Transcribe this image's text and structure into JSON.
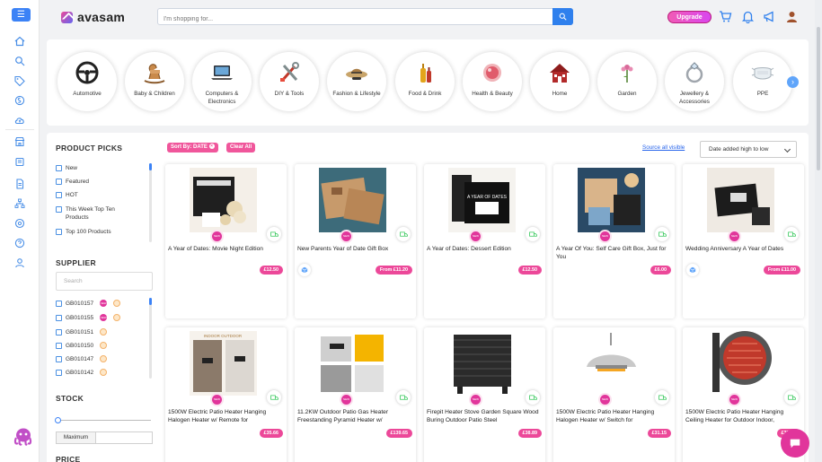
{
  "header": {
    "brand": "avasam",
    "search_placeholder": "I'm shopping for...",
    "upgrade_label": "Upgrade"
  },
  "categories": [
    {
      "label": "Automotive",
      "icon": "steering-wheel-icon"
    },
    {
      "label": "Baby & Children",
      "icon": "rocking-horse-icon"
    },
    {
      "label": "Computers & Electronics",
      "icon": "laptop-icon"
    },
    {
      "label": "DIY & Tools",
      "icon": "tools-icon"
    },
    {
      "label": "Fashion & Lifestyle",
      "icon": "hat-icon"
    },
    {
      "label": "Food & Drink",
      "icon": "bottles-icon"
    },
    {
      "label": "Health & Beauty",
      "icon": "compact-icon"
    },
    {
      "label": "Home",
      "icon": "house-icon"
    },
    {
      "label": "Garden",
      "icon": "flower-icon"
    },
    {
      "label": "Jewellery & Accessories",
      "icon": "ring-icon"
    },
    {
      "label": "PPE",
      "icon": "mask-icon"
    }
  ],
  "filters": {
    "product_picks_title": "PRODUCT PICKS",
    "product_picks": [
      "New",
      "Featured",
      "HOT",
      "This Week Top Ten Products",
      "Top 100 Products"
    ],
    "supplier_title": "SUPPLIER",
    "supplier_search_placeholder": "Search",
    "suppliers": [
      {
        "code": "GB010157",
        "new": true,
        "fire": true
      },
      {
        "code": "GB010155",
        "new": true,
        "fire": true
      },
      {
        "code": "GB010151",
        "new": false,
        "fire": true
      },
      {
        "code": "GB010150",
        "new": false,
        "fire": true
      },
      {
        "code": "GB010147",
        "new": false,
        "fire": true
      },
      {
        "code": "GB010142",
        "new": false,
        "fire": true
      }
    ],
    "stock_title": "STOCK",
    "maximum_label": "Maximum",
    "price_title": "PRICE"
  },
  "toolbar": {
    "sort_pill": "Sort By: DATE",
    "clear_all": "Clear All",
    "source_all_visible": "Source all visible",
    "sort_select": "Date added high to low"
  },
  "products": [
    {
      "title": "A Year of Dates: Movie Night Edition",
      "price": "£12.50",
      "cube": false
    },
    {
      "title": "New Parents Year of Date Gift Box",
      "price": "From £11.20",
      "cube": true
    },
    {
      "title": "A Year of Dates: Dessert Edition",
      "price": "£12.50",
      "cube": false
    },
    {
      "title": "A Year Of You: Self Care Gift Box, Just for You",
      "price": "£6.00",
      "cube": false
    },
    {
      "title": "Wedding Anniversary A Year of Dates",
      "price": "From £11.00",
      "cube": true
    },
    {
      "title": "1500W Electric Patio Heater Hanging Halogen Heater w/ Remote for",
      "price": "£35.66",
      "cube": false
    },
    {
      "title": "11.2KW Outdoor Patio Gas Heater Freestanding Pyramid Heater w/",
      "price": "£139.65",
      "cube": false
    },
    {
      "title": "Firepit Heater Stove Garden Square Wood Buring Outdoor Patio Steel",
      "price": "£38.89",
      "cube": false
    },
    {
      "title": "1500W Electric Patio Heater Hanging Halogen Heater w/ Switch for",
      "price": "£31.15",
      "cube": false
    },
    {
      "title": "1500W Electric Patio Heater Hanging Ceiling Heater for Outdoor Indoor,",
      "price": "£35.66",
      "cube": false
    }
  ],
  "image_texts": {
    "dessert_box": "A YEAR OF DATES",
    "heater_banner": "INDOOR OUTDOOR"
  },
  "colors": {
    "accent_blue": "#2f80ed",
    "brand_pink": "#ec4899",
    "new_badge": "#e1359b"
  }
}
